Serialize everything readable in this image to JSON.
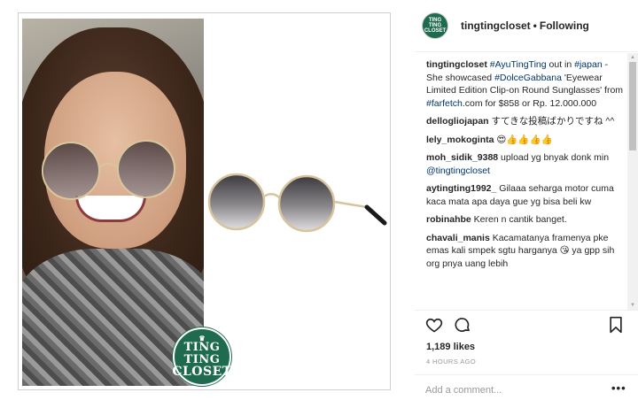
{
  "header": {
    "avatar_text": "TING TING CLOSET",
    "username": "tingtingcloset",
    "separator": "•",
    "follow_status": "Following"
  },
  "image": {
    "logo_line1": "TING TING",
    "logo_line2": "CLOSET",
    "brand_color": "#1f6b4f"
  },
  "comments": [
    {
      "user": "tingtingcloset",
      "parts": [
        {
          "t": " "
        },
        {
          "t": "#AyuTingTing",
          "tag": true
        },
        {
          "t": " out in "
        },
        {
          "t": "#japan",
          "tag": true
        },
        {
          "t": " - She showcased "
        },
        {
          "t": "#DolceGabbana",
          "tag": true
        },
        {
          "t": " 'Eyewear Limited Edition Clip-on Round Sunglasses' from "
        },
        {
          "t": "#farfetch",
          "tag": true
        },
        {
          "t": ".com for $858 or Rp. 12.000.000"
        }
      ]
    },
    {
      "user": "dellogliojapan",
      "parts": [
        {
          "t": " すてきな投稿ばかりですね ^^"
        }
      ]
    },
    {
      "user": "lely_mokoginta",
      "parts": [
        {
          "t": " 😍👍👍👍👍"
        }
      ]
    },
    {
      "user": "moh_sidik_9388",
      "parts": [
        {
          "t": " upload yg bnyak donk min "
        },
        {
          "t": "@tingtingcloset",
          "tag": true
        }
      ]
    },
    {
      "user": "aytingting1992_",
      "parts": [
        {
          "t": " Gilaaa seharga motor cuma kaca mata apa daya gue yg bisa beli kw"
        }
      ]
    },
    {
      "user": "robinahbe",
      "parts": [
        {
          "t": " Keren n cantik banget."
        }
      ]
    },
    {
      "user": "chavali_manis",
      "parts": [
        {
          "t": " Kacamatanya framenya pke emas kali smpek sgtu harganya 😘 ya gpp sih org pnya uang lebih"
        }
      ]
    }
  ],
  "actions": {
    "like_icon": "heart-outline-icon",
    "comment_icon": "comment-bubble-icon",
    "save_icon": "bookmark-icon"
  },
  "likes": "1,189 likes",
  "timestamp": "4 HOURS AGO",
  "add_comment": {
    "placeholder": "Add a comment...",
    "value": ""
  },
  "more_options": "•••",
  "colors": {
    "text": "#262626",
    "link": "#003569",
    "muted": "#999999",
    "divider": "#efefef"
  }
}
